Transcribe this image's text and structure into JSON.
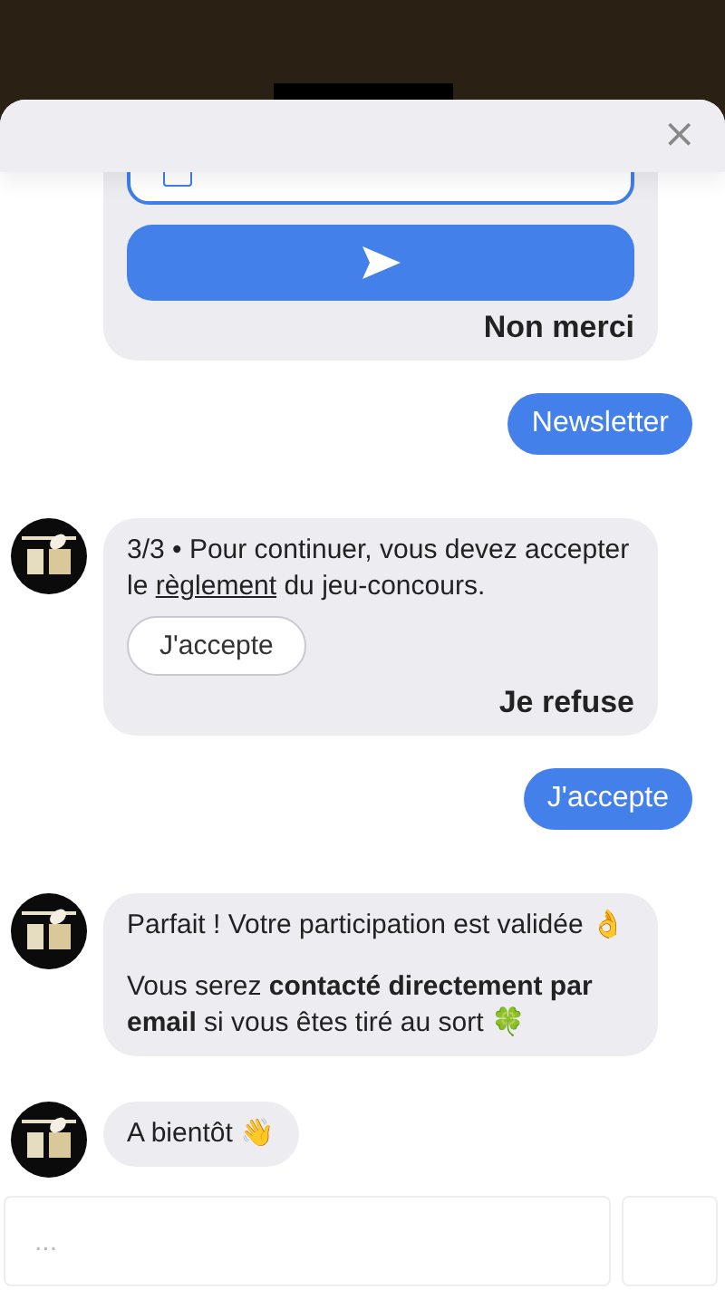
{
  "header": {
    "close": "×"
  },
  "messages": [
    {
      "kind": "form",
      "field": {
        "checked": false
      },
      "decline": "Non merci"
    },
    {
      "kind": "user_text",
      "paragraphs": [
        "Newsletter"
      ]
    },
    {
      "kind": "consent",
      "text_before": "3/3 • Pour continuer, vous devez accepter le ",
      "link": "règlement",
      "text_after": " du jeu-concours.",
      "buttons": [
        "J'accepte"
      ],
      "decline": "Je refuse"
    },
    {
      "kind": "user_text",
      "paragraphs": [
        "J'accepte"
      ]
    },
    {
      "kind": "bot_text",
      "paragraphs": [
        "Parfait ! Votre participation est validée 👌",
        "Vous serez **contacté directement par email** si vous êtes tiré au sort 🍀"
      ]
    },
    {
      "kind": "bot_text",
      "paragraphs": [
        "A bientôt 👋"
      ]
    }
  ],
  "composer": {
    "placeholder": "..."
  }
}
